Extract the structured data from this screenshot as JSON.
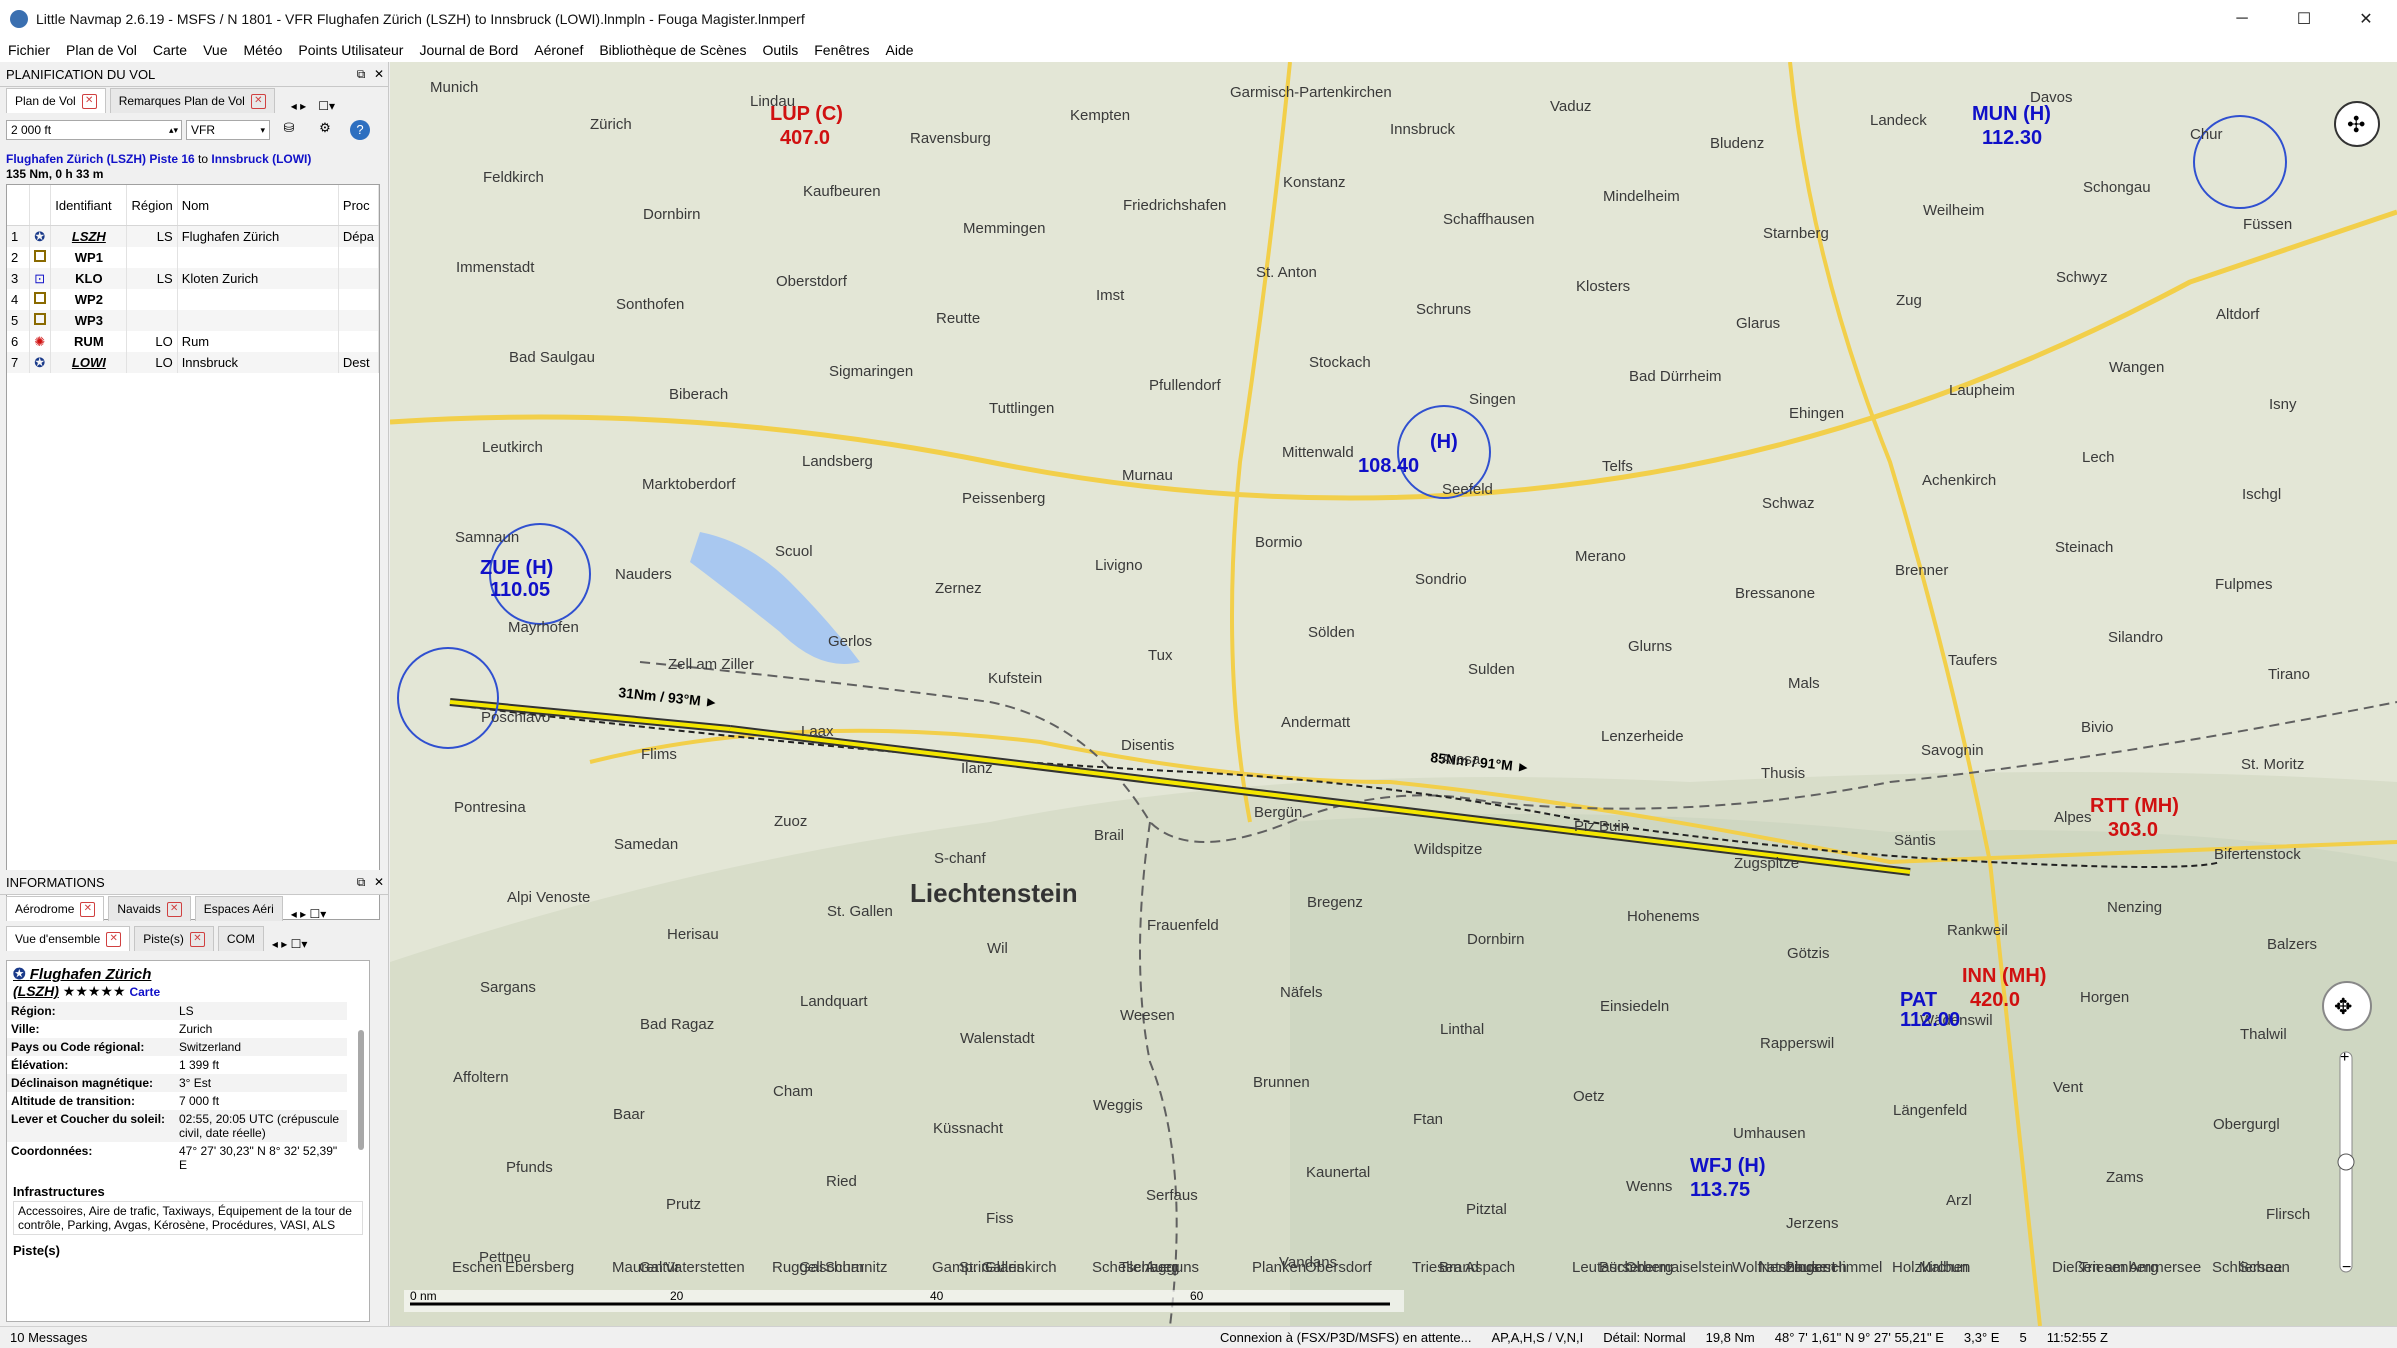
{
  "window": {
    "title": "Little Navmap 2.6.19 - MSFS / N 1801 - VFR Flughafen Zürich (LSZH) to Innsbruck (LOWI).lnmpln - Fouga Magister.lnmperf",
    "minimize": "─",
    "maximize": "☐",
    "close": "✕"
  },
  "menu": [
    "Fichier",
    "Plan de Vol",
    "Carte",
    "Vue",
    "Météo",
    "Points Utilisateur",
    "Journal de Bord",
    "Aéronef",
    "Bibliothèque de Scènes",
    "Outils",
    "Fenêtres",
    "Aide"
  ],
  "flightplan_panel": {
    "title": "PLANIFICATION DU VOL",
    "tabs": [
      "Plan de Vol",
      "Remarques Plan de Vol"
    ],
    "altitude": "2 000 ft",
    "rules": "VFR",
    "summary_from": "Flughafen Zürich (LSZH) Piste 16",
    "summary_to_word": "to",
    "summary_to": "Innsbruck (LOWI)",
    "summary_distance": "135 Nm, 0 h 33 m",
    "columns": [
      "Identifiant",
      "Région",
      "Nom",
      "Proc"
    ],
    "rows": [
      {
        "n": "1",
        "ident": "LSZH",
        "region": "LS",
        "name": "Flughafen Zürich",
        "proc": "Dépa"
      },
      {
        "n": "2",
        "ident": "WP1",
        "region": "",
        "name": "",
        "proc": ""
      },
      {
        "n": "3",
        "ident": "KLO",
        "region": "LS",
        "name": "Kloten Zurich",
        "proc": ""
      },
      {
        "n": "4",
        "ident": "WP2",
        "region": "",
        "name": "",
        "proc": ""
      },
      {
        "n": "5",
        "ident": "WP3",
        "region": "",
        "name": "",
        "proc": ""
      },
      {
        "n": "6",
        "ident": "RUM",
        "region": "LO",
        "name": "Rum",
        "proc": ""
      },
      {
        "n": "7",
        "ident": "LOWI",
        "region": "LO",
        "name": "Innsbruck",
        "proc": "Dest"
      }
    ]
  },
  "info_panel": {
    "title": "INFORMATIONS",
    "tabs": [
      "Aérodrome",
      "Navaids",
      "Espaces Aéri"
    ],
    "subtabs": [
      "Vue d'ensemble",
      "Piste(s)",
      "COM"
    ],
    "airport_name": "Flughafen Zürich",
    "airport_ident": "(LSZH)",
    "stars": "★★★★★",
    "carte": "Carte",
    "fields": [
      {
        "k": "Région:",
        "v": "LS"
      },
      {
        "k": "Ville:",
        "v": "Zurich"
      },
      {
        "k": "Pays ou Code régional:",
        "v": "Switzerland"
      },
      {
        "k": "Élévation:",
        "v": "1 399 ft"
      },
      {
        "k": "Déclinaison magnétique:",
        "v": "3° Est"
      },
      {
        "k": "Altitude de transition:",
        "v": "7 000 ft"
      },
      {
        "k": "Lever et Coucher du soleil:",
        "v": "02:55, 20:05 UTC (crépuscule civil, date réelle)"
      },
      {
        "k": "Coordonnées:",
        "v": "47° 27' 30,23\" N 8° 32' 52,39\" E"
      }
    ],
    "infra_title": "Infrastructures",
    "infra_text": "Accessoires, Aire de trafic, Taxiways, Équipement de la tour de contrôle, Parking, Avgas, Kérosène, Procédures, VASI, ALS",
    "pistes_title": "Piste(s)"
  },
  "status": {
    "messages": "10 Messages",
    "connection": "Connexion à (FSX/P3D/MSFS) en attente...",
    "flags": "AP,A,H,S / V,N,I",
    "detail": "Détail: Normal",
    "distance": "19,8 Nm",
    "coords": "48° 7' 1,61\" N 9° 27' 55,21\" E",
    "mag": "3,3° E",
    "zoom": "5",
    "time": "11:52:55 Z"
  },
  "map": {
    "legs": [
      {
        "label": "31Nm / 93°M ►"
      },
      {
        "label": "85Nm / 91°M ►"
      }
    ],
    "scale": [
      "0 nm",
      "20",
      "40",
      "60"
    ],
    "countries": [
      "Liechtenstein"
    ],
    "cities": [
      "Munich",
      "Zürich",
      "Lindau",
      "Ravensburg",
      "Kempten",
      "Garmisch-Partenkirchen",
      "Innsbruck",
      "Vaduz",
      "Bludenz",
      "Landeck",
      "Davos",
      "Chur",
      "Feldkirch",
      "Dornbirn",
      "Kaufbeuren",
      "Memmingen",
      "Friedrichshafen",
      "Konstanz",
      "Schaffhausen",
      "Mindelheim",
      "Starnberg",
      "Weilheim",
      "Schongau",
      "Füssen",
      "Immenstadt",
      "Sonthofen",
      "Oberstdorf",
      "Reutte",
      "Imst",
      "St. Anton",
      "Schruns",
      "Klosters",
      "Glarus",
      "Zug",
      "Schwyz",
      "Altdorf",
      "Bad Saulgau",
      "Biberach",
      "Sigmaringen",
      "Tuttlingen",
      "Pfullendorf",
      "Stockach",
      "Singen",
      "Bad Dürrheim",
      "Ehingen",
      "Laupheim",
      "Wangen",
      "Isny",
      "Leutkirch",
      "Marktoberdorf",
      "Landsberg",
      "Peissenberg",
      "Murnau",
      "Mittenwald",
      "Seefeld",
      "Telfs",
      "Schwaz",
      "Achenkirch",
      "Lech",
      "Ischgl",
      "Samnaun",
      "Nauders",
      "Scuol",
      "Zernez",
      "Livigno",
      "Bormio",
      "Sondrio",
      "Merano",
      "Bressanone",
      "Brenner",
      "Steinach",
      "Fulpmes",
      "Mayrhofen",
      "Zell am Ziller",
      "Gerlos",
      "Kufstein",
      "Tux",
      "Sölden",
      "Sulden",
      "Glurns",
      "Mals",
      "Taufers",
      "Silandro",
      "Tirano",
      "Poschiavo",
      "Flims",
      "Laax",
      "Ilanz",
      "Disentis",
      "Andermatt",
      "Arosa",
      "Lenzerheide",
      "Thusis",
      "Savognin",
      "Bivio",
      "St. Moritz",
      "Pontresina",
      "Samedan",
      "Zuoz",
      "S-chanf",
      "Brail",
      "Bergün",
      "Wildspitze",
      "Piz Buin",
      "Zugspitze",
      "Säntis",
      "Alpes",
      "Bifertenstock",
      "Alpi Venoste",
      "Herisau",
      "St. Gallen",
      "Wil",
      "Frauenfeld",
      "Bregenz",
      "Dornbirn",
      "Hohenems",
      "Götzis",
      "Rankweil",
      "Nenzing",
      "Balzers",
      "Sargans",
      "Bad Ragaz",
      "Landquart",
      "Walenstadt",
      "Weesen",
      "Näfels",
      "Linthal",
      "Einsiedeln",
      "Rapperswil",
      "Wädenswil",
      "Horgen",
      "Thalwil",
      "Affoltern",
      "Baar",
      "Cham",
      "Küssnacht",
      "Weggis",
      "Brunnen",
      "Ftan",
      "Oetz",
      "Umhausen",
      "Längenfeld",
      "Vent",
      "Obergurgl",
      "Pfunds",
      "Prutz",
      "Ried",
      "Fiss",
      "Serfaus",
      "Kaunertal",
      "Pitztal",
      "Wenns",
      "Jerzens",
      "Arzl",
      "Zams",
      "Flirsch",
      "Pettneu",
      "Galtür",
      "Gaschurn",
      "St. Gallenkirch",
      "Tschagguns",
      "Vandans",
      "Brand",
      "Bürserberg",
      "Nenzinger Himmel",
      "Malbun",
      "Triesenberg",
      "Schaan",
      "Eschen",
      "Mauren",
      "Ruggell",
      "Gamprin",
      "Schellenberg",
      "Planken",
      "Triesen",
      "Leutasch",
      "Wolfratshausen",
      "Holzkirchen",
      "Dießen am Ammersee",
      "Schliersee",
      "Ebersberg",
      "Vaterstetten",
      "Scharnitz",
      "Glaris",
      "Auer",
      "Obersdorf",
      "Aspach",
      "Obermaiselstein",
      "Bludesch"
    ]
  },
  "colors": {
    "route": "#f3e600",
    "route_outline": "#333333",
    "vor_blue": "#1010c8",
    "ndb_red": "#d01010",
    "airport_purple": "#8a1a5a",
    "map_bg": "#e6e4d8"
  }
}
